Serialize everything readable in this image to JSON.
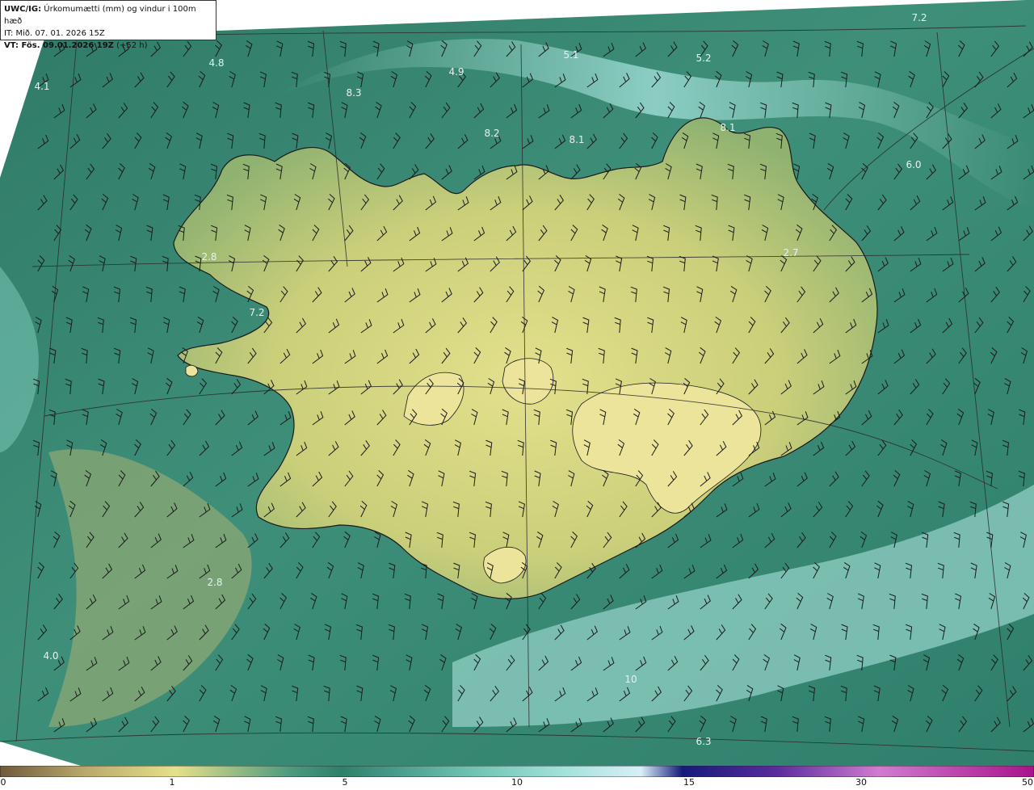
{
  "header": {
    "product": "UWC/IG:",
    "description": "Úrkomumætti (mm) og vindur i 100m hæð",
    "it_label": "IT: Mið. 07. 01. 2026 15Z",
    "vt_bold": "VT: Fös. 09.01.2026 19Z",
    "vt_extra": "(+52 h)"
  },
  "field_values": [
    {
      "id": "v1",
      "text": "4.1"
    },
    {
      "id": "v2",
      "text": "4.8"
    },
    {
      "id": "v3",
      "text": "8.3"
    },
    {
      "id": "v4",
      "text": "4.9"
    },
    {
      "id": "v5",
      "text": "5.1"
    },
    {
      "id": "v6",
      "text": "5.2"
    },
    {
      "id": "v7",
      "text": "7.2"
    },
    {
      "id": "v8",
      "text": "8.2"
    },
    {
      "id": "v9",
      "text": "8.1"
    },
    {
      "id": "v10",
      "text": "8.1"
    },
    {
      "id": "v11",
      "text": "6.0"
    },
    {
      "id": "v12",
      "text": "2.8"
    },
    {
      "id": "v13",
      "text": "2.7"
    },
    {
      "id": "v14",
      "text": "7.2"
    },
    {
      "id": "v15",
      "text": "2.8"
    },
    {
      "id": "v16",
      "text": "4.0"
    },
    {
      "id": "v17",
      "text": "10"
    },
    {
      "id": "v18",
      "text": "6.3"
    }
  ],
  "colorbar": {
    "ticks": [
      "0",
      "1",
      "5",
      "10",
      "15",
      "30",
      "50"
    ],
    "colors": [
      "#6f5a3a",
      "#b8a76c",
      "#e6e08a",
      "#2f7f6c",
      "#a6e3dc",
      "#d9eef8",
      "#151a7a",
      "#5a2b9c",
      "#d07cd0",
      "#a7148a"
    ]
  },
  "palette": {
    "sea_dark": "#2f7a68",
    "sea_light": "#8fd0c4",
    "land_low": "#cbcf7a",
    "land_high": "#e3e08c",
    "coast": "#1a1a1a",
    "grid": "#2a2a2a"
  }
}
